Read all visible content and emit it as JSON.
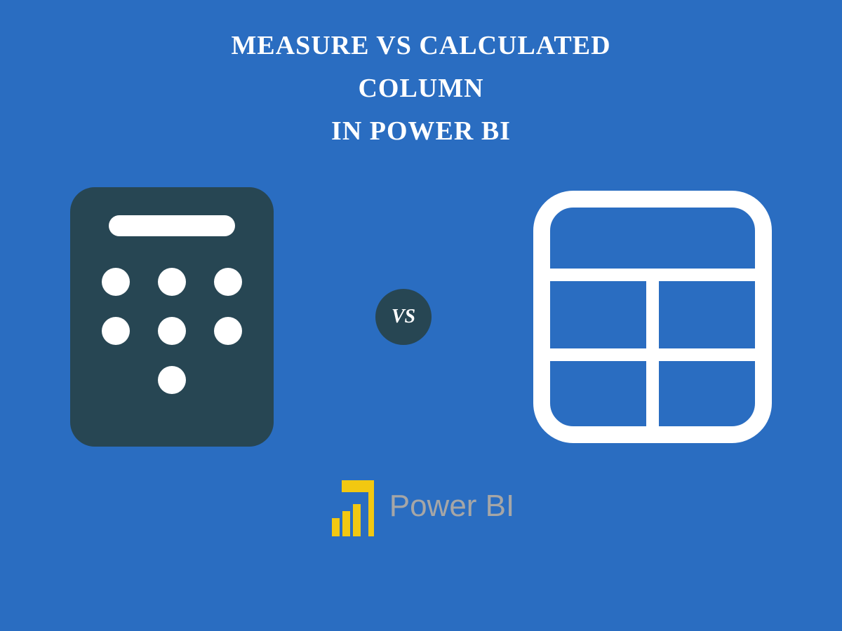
{
  "title": {
    "line1": "MEASURE VS CALCULATED",
    "line2": "COLUMN",
    "line3": "IN  POWER BI"
  },
  "vs_label": "VS",
  "logo_text": "Power BI",
  "colors": {
    "background": "#2a6dc1",
    "dark_teal": "#274653",
    "white": "#ffffff",
    "powerbi_yellow": "#f2c811",
    "powerbi_gray": "#a6a6a6"
  }
}
